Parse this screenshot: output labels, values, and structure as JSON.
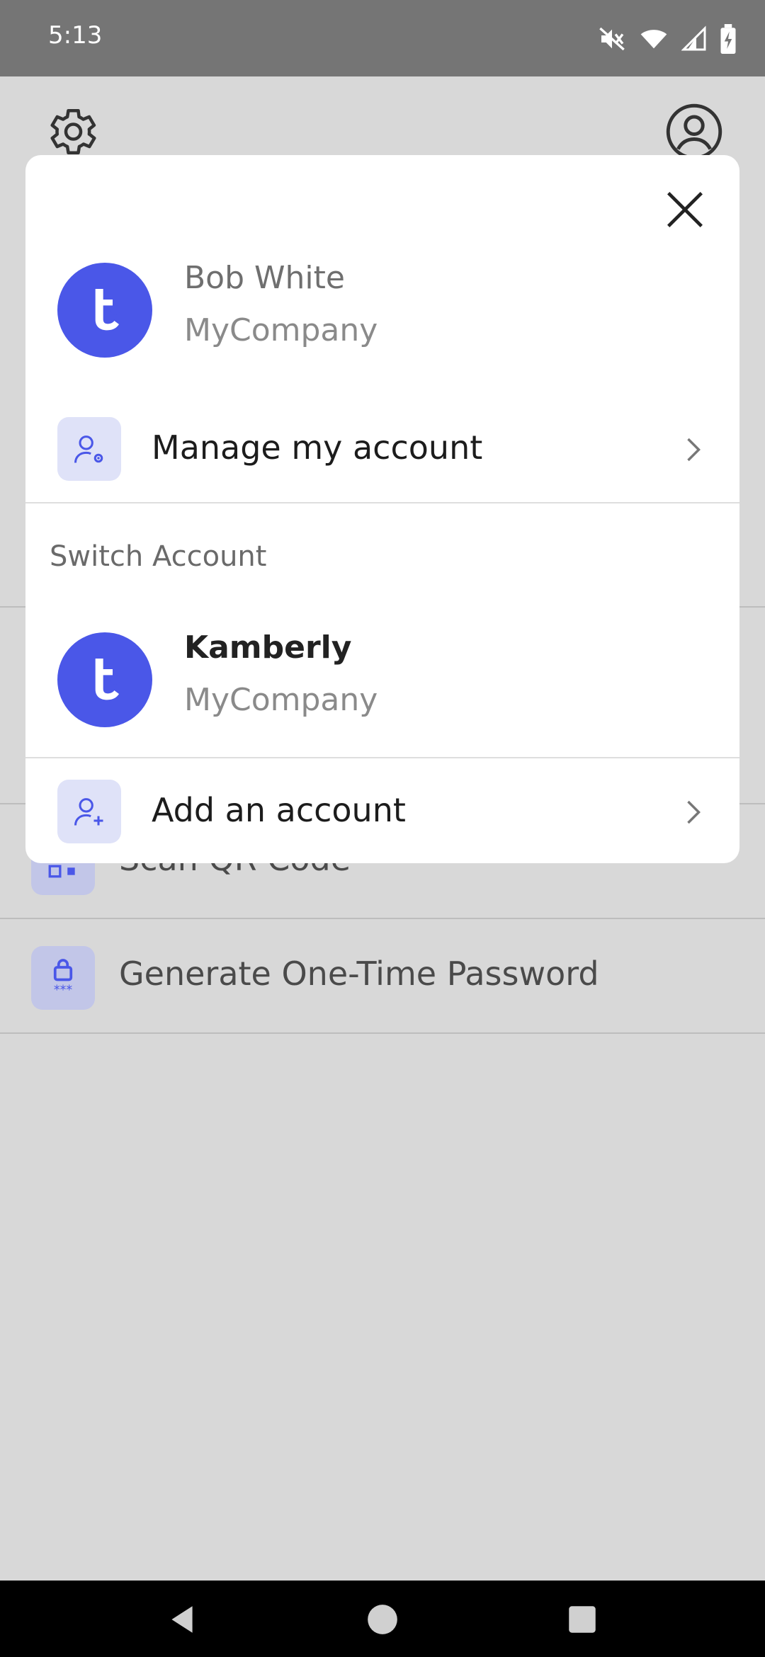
{
  "status_bar": {
    "time": "5:13"
  },
  "background": {
    "rows": [
      {
        "label": "Scan QR Code"
      },
      {
        "label": "Generate One-Time Password"
      }
    ]
  },
  "modal": {
    "current_account": {
      "name": "Bob White",
      "company": "MyCompany"
    },
    "manage_label": "Manage my account",
    "switch_title": "Switch Account",
    "other_account": {
      "name": "Kamberly",
      "company": "MyCompany"
    },
    "add_label": "Add an account"
  },
  "colors": {
    "brand": "#4a57e8",
    "icon_bg": "#dfe2f8",
    "scrim": "#d8d8d8"
  }
}
